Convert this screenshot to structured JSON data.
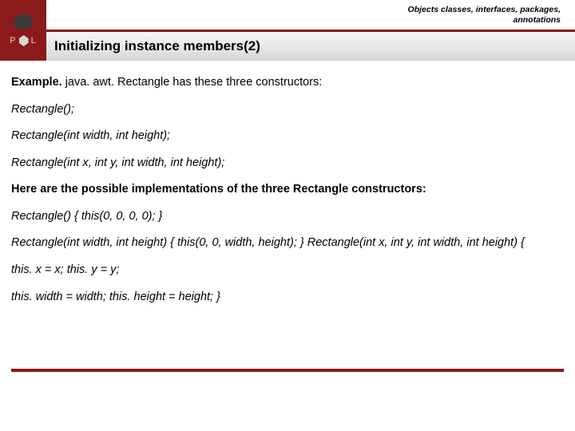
{
  "header": {
    "breadcrumb_line1": "Objects classes, interfaces, packages,",
    "breadcrumb_line2": "annotations",
    "logo_letters_left": "P",
    "logo_letters_right": "L",
    "title": "Initializing instance members(2)"
  },
  "body": {
    "lead_bold": "Example.",
    "lead_rest": " java. awt. Rectangle has these three constructors:",
    "sig1": "Rectangle();",
    "sig2": "Rectangle(int width, int height);",
    "sig3": "Rectangle(int x, int y, int width, int height);",
    "impl_heading": "Here are the possible implementations of the three Rectangle constructors:",
    "impl1": "Rectangle() { this(0, 0, 0, 0); }",
    "impl2": "Rectangle(int width, int height) { this(0, 0, width, height); } Rectangle(int x, int y, int width, int height) {",
    "impl3": "this. x = x; this. y = y;",
    "impl4": "this. width = width; this. height = height; }"
  }
}
